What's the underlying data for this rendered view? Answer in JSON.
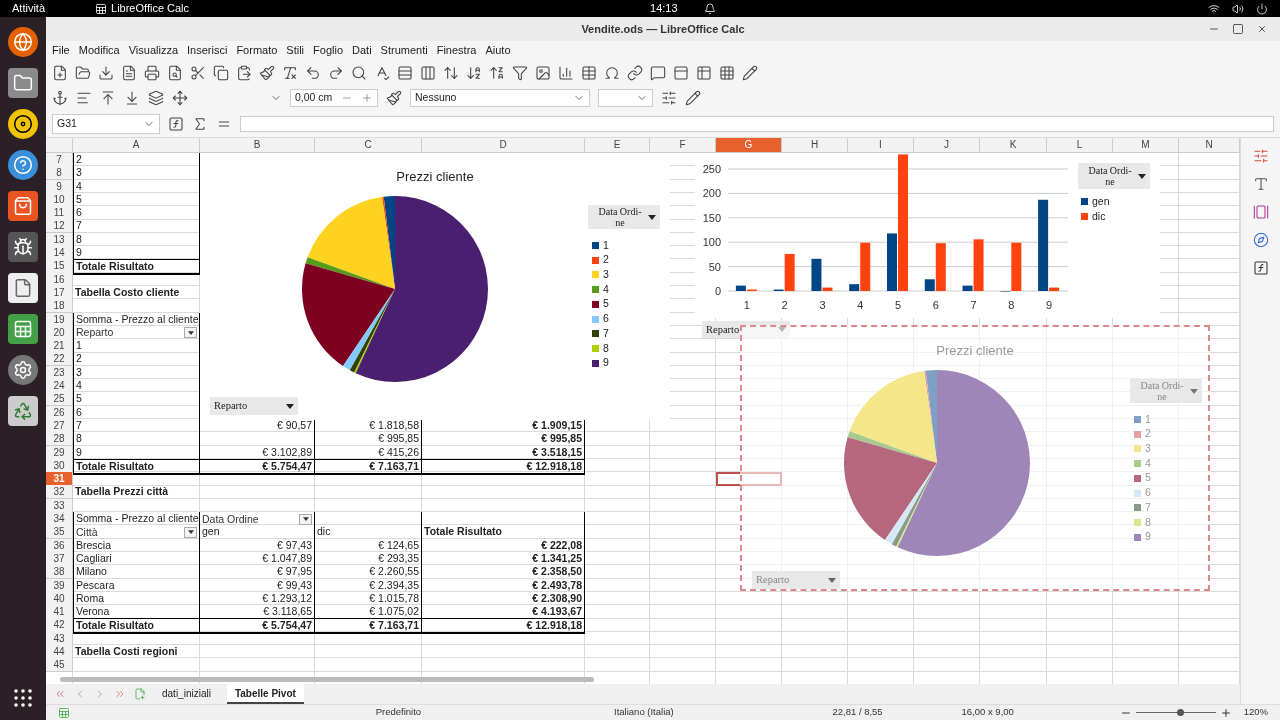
{
  "topbar": {
    "activities": "Attività",
    "app": "LibreOffice Calc",
    "clock": "14:13"
  },
  "window": {
    "title": "Vendite.ods — LibreOffice Calc"
  },
  "menu": [
    "File",
    "Modifica",
    "Visualizza",
    "Inserisci",
    "Formato",
    "Stili",
    "Foglio",
    "Dati",
    "Strumenti",
    "Finestra",
    "Aiuto"
  ],
  "toolbar": {
    "offset": "0,00 cm",
    "border_style": "Nessuno"
  },
  "formula_bar": {
    "name_box": "G31"
  },
  "columns": [
    {
      "label": "A",
      "selected": false
    },
    {
      "label": "B",
      "selected": false
    },
    {
      "label": "C",
      "selected": false
    },
    {
      "label": "D",
      "selected": false
    },
    {
      "label": "E",
      "selected": false
    },
    {
      "label": "F",
      "selected": false
    },
    {
      "label": "G",
      "selected": true
    },
    {
      "label": "H",
      "selected": false
    },
    {
      "label": "I",
      "selected": false
    },
    {
      "label": "J",
      "selected": false
    },
    {
      "label": "K",
      "selected": false
    },
    {
      "label": "L",
      "selected": false
    },
    {
      "label": "M",
      "selected": false
    },
    {
      "label": "N",
      "selected": false
    }
  ],
  "rows": [
    {
      "n": "7",
      "selected": false,
      "kind": "label",
      "cells": [
        "2"
      ]
    },
    {
      "n": "8",
      "selected": false,
      "kind": "label",
      "cells": [
        "3"
      ]
    },
    {
      "n": "9",
      "selected": false,
      "kind": "label",
      "cells": [
        "4"
      ]
    },
    {
      "n": "10",
      "selected": false,
      "kind": "label",
      "cells": [
        "5"
      ]
    },
    {
      "n": "11",
      "selected": false,
      "kind": "label",
      "cells": [
        "6"
      ]
    },
    {
      "n": "12",
      "selected": false,
      "kind": "label",
      "cells": [
        "7"
      ]
    },
    {
      "n": "13",
      "selected": false,
      "kind": "label",
      "cells": [
        "8"
      ]
    },
    {
      "n": "14",
      "selected": false,
      "kind": "label",
      "cells": [
        "9"
      ]
    },
    {
      "n": "15",
      "selected": false,
      "kind": "total",
      "cells": [
        "Totale Risultato"
      ]
    },
    {
      "n": "16",
      "selected": false,
      "kind": "blank"
    },
    {
      "n": "17",
      "selected": false,
      "kind": "title",
      "cells": [
        "Tabella Costo cliente"
      ]
    },
    {
      "n": "18",
      "selected": false,
      "kind": "blank"
    },
    {
      "n": "19",
      "selected": false,
      "kind": "label",
      "cells": [
        "Somma - Prezzo al cliente"
      ]
    },
    {
      "n": "20",
      "selected": false,
      "kind": "dropdown",
      "cells": [
        "Reparto"
      ]
    },
    {
      "n": "21",
      "selected": false,
      "kind": "label",
      "cells": [
        "1"
      ]
    },
    {
      "n": "22",
      "selected": false,
      "kind": "label",
      "cells": [
        "2"
      ]
    },
    {
      "n": "23",
      "selected": false,
      "kind": "label",
      "cells": [
        "3"
      ]
    },
    {
      "n": "24",
      "selected": false,
      "kind": "label",
      "cells": [
        "4"
      ]
    },
    {
      "n": "25",
      "selected": false,
      "kind": "label",
      "cells": [
        "5"
      ]
    },
    {
      "n": "26",
      "selected": false,
      "kind": "label",
      "cells": [
        "6"
      ]
    },
    {
      "n": "27",
      "selected": false,
      "kind": "data",
      "cells": [
        "7",
        "€ 90,57",
        "€ 1.818,58",
        "€ 1.909,15"
      ]
    },
    {
      "n": "28",
      "selected": false,
      "kind": "data",
      "cells": [
        "8",
        null,
        "€ 995,85",
        "€ 995,85"
      ]
    },
    {
      "n": "29",
      "selected": false,
      "kind": "data",
      "cells": [
        "9",
        "€ 3.102,89",
        "€ 415,26",
        "€ 3.518,15"
      ]
    },
    {
      "n": "30",
      "selected": false,
      "kind": "total",
      "cells": [
        "Totale Risultato",
        "€ 5.754,47",
        "€ 7.163,71",
        "€ 12.918,18"
      ]
    },
    {
      "n": "31",
      "selected": true,
      "kind": "blank"
    },
    {
      "n": "32",
      "selected": false,
      "kind": "title",
      "cells": [
        "Tabella Prezzi città"
      ]
    },
    {
      "n": "33",
      "selected": false,
      "kind": "blank"
    },
    {
      "n": "34",
      "selected": false,
      "kind": "field",
      "cells": [
        "Somma - Prezzo al cliente",
        "Data Ordine"
      ]
    },
    {
      "n": "35",
      "selected": false,
      "kind": "head",
      "cells": [
        "Città",
        "gen",
        "dic",
        "Totale Risultato"
      ]
    },
    {
      "n": "36",
      "selected": false,
      "kind": "data",
      "cells": [
        "Brescia",
        "€ 97,43",
        "€ 124,65",
        "€ 222,08"
      ]
    },
    {
      "n": "37",
      "selected": false,
      "kind": "data",
      "cells": [
        "Cagliari",
        "€ 1.047,89",
        "€ 293,35",
        "€ 1.341,25"
      ]
    },
    {
      "n": "38",
      "selected": false,
      "kind": "data",
      "cells": [
        "Milano",
        "€ 97,95",
        "€ 2.260,55",
        "€ 2.358,50"
      ]
    },
    {
      "n": "39",
      "selected": false,
      "kind": "data",
      "cells": [
        "Pescara",
        "€ 99,43",
        "€ 2.394,35",
        "€ 2.493,78"
      ]
    },
    {
      "n": "40",
      "selected": false,
      "kind": "data",
      "cells": [
        "Roma",
        "€ 1.293,12",
        "€ 1.015,78",
        "€ 2.308,90"
      ]
    },
    {
      "n": "41",
      "selected": false,
      "kind": "data",
      "cells": [
        "Verona",
        "€ 3.118,65",
        "€ 1.075,02",
        "€ 4.193,67"
      ]
    },
    {
      "n": "42",
      "selected": false,
      "kind": "total",
      "cells": [
        "Totale Risultato",
        "€ 5.754,47",
        "€ 7.163,71",
        "€ 12.918,18"
      ]
    },
    {
      "n": "43",
      "selected": false,
      "kind": "blank"
    },
    {
      "n": "44",
      "selected": false,
      "kind": "title",
      "cells": [
        "Tabella Costi regioni"
      ]
    },
    {
      "n": "45",
      "selected": false,
      "kind": "blank"
    }
  ],
  "pie_charts": [
    {
      "title": "Prezzi cliente",
      "selected": false,
      "legend_title": "Data Ordi-\nne",
      "filter": "Reparto",
      "legend": [
        {
          "label": "1",
          "color": "#004586"
        },
        {
          "label": "2",
          "color": "#ff420e"
        },
        {
          "label": "3",
          "color": "#ffd320"
        },
        {
          "label": "4",
          "color": "#579d1c"
        },
        {
          "label": "5",
          "color": "#7e0021"
        },
        {
          "label": "6",
          "color": "#83caff"
        },
        {
          "label": "7",
          "color": "#314004"
        },
        {
          "label": "8",
          "color": "#aecf00"
        },
        {
          "label": "9",
          "color": "#4b1f6f"
        }
      ]
    },
    {
      "title": "Prezzi cliente",
      "selected": true,
      "legend_title": "Data Ordi-\nne",
      "filter": "Reparto",
      "legend": [
        {
          "label": "1",
          "color": "#7f9fc4"
        },
        {
          "label": "2",
          "color": "#e4a0a0"
        },
        {
          "label": "3",
          "color": "#f6e68a"
        },
        {
          "label": "4",
          "color": "#a9c98f"
        },
        {
          "label": "5",
          "color": "#b5677e"
        },
        {
          "label": "6",
          "color": "#d6e8f5"
        },
        {
          "label": "7",
          "color": "#8a9a88"
        },
        {
          "label": "8",
          "color": "#d8e88a"
        },
        {
          "label": "9",
          "color": "#9e86b8"
        }
      ]
    }
  ],
  "bar_chart": {
    "legend_title": "Data Ordi-\nne",
    "filter": "Reparto",
    "chart_data": {
      "type": "bar",
      "categories": [
        "1",
        "2",
        "3",
        "4",
        "5",
        "6",
        "7",
        "8",
        "9"
      ],
      "series": [
        {
          "name": "gen",
          "color": "#004586",
          "values": [
            11,
            3,
            66,
            14,
            118,
            24,
            11,
            0,
            187
          ]
        },
        {
          "name": "dic",
          "color": "#ff420e",
          "values": [
            3,
            76,
            7,
            99,
            280,
            98,
            106,
            99,
            7
          ]
        }
      ],
      "ylim": [
        0,
        280
      ],
      "yticks": [
        0,
        50,
        100,
        150,
        200,
        250
      ],
      "grid": true,
      "legend": "right"
    }
  },
  "sheet_tabs": [
    {
      "label": "dati_iniziali",
      "selected": false
    },
    {
      "label": "Tabelle Pivot",
      "selected": true
    }
  ],
  "status_bar": {
    "page_style": "Predefinito",
    "language": "Italiano (Italia)",
    "position": "22,81 / 8,55",
    "size": "16,00 x 9,00",
    "zoom": "120%",
    "zoom_slider": {
      "level": 0.55
    }
  }
}
